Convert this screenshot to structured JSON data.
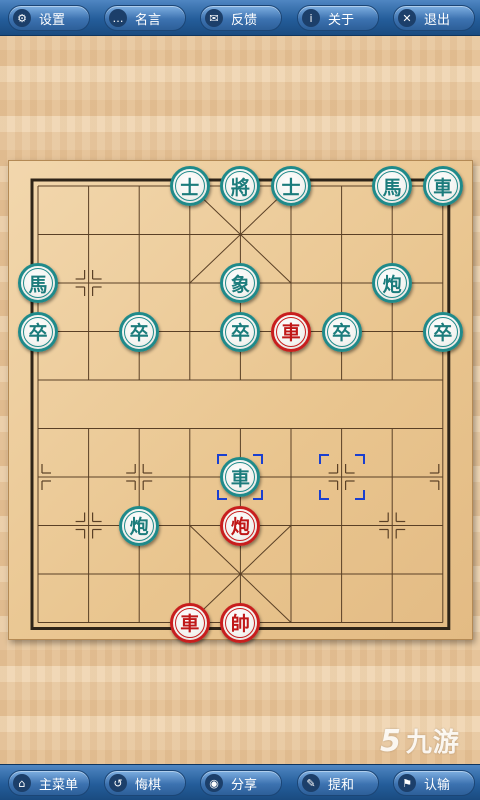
{
  "top_bar": {
    "buttons": [
      {
        "label": "设置",
        "icon": "gear-icon",
        "glyph": "⚙"
      },
      {
        "label": "名言",
        "icon": "speech-bubble-icon",
        "glyph": "…"
      },
      {
        "label": "反馈",
        "icon": "mail-icon",
        "glyph": "✉"
      },
      {
        "label": "关于",
        "icon": "info-icon",
        "glyph": "i"
      },
      {
        "label": "退出",
        "icon": "close-icon",
        "glyph": "✕"
      }
    ]
  },
  "bottom_bar": {
    "buttons": [
      {
        "label": "主菜单",
        "icon": "home-icon",
        "glyph": "⌂"
      },
      {
        "label": "悔棋",
        "icon": "undo-icon",
        "glyph": "↺"
      },
      {
        "label": "分享",
        "icon": "share-icon",
        "glyph": "◉"
      },
      {
        "label": "提和",
        "icon": "pen-icon",
        "glyph": "✎"
      },
      {
        "label": "认输",
        "icon": "flag-icon",
        "glyph": "⚑"
      }
    ]
  },
  "board": {
    "files": 9,
    "ranks": 10,
    "colors": {
      "black": "#1f8a8a",
      "red": "#c81e1e",
      "selection": "#1a3fd0"
    },
    "pieces": [
      {
        "side": "black",
        "char": "士",
        "file": 3,
        "rank": 0
      },
      {
        "side": "black",
        "char": "將",
        "file": 4,
        "rank": 0
      },
      {
        "side": "black",
        "char": "士",
        "file": 5,
        "rank": 0
      },
      {
        "side": "black",
        "char": "馬",
        "file": 7,
        "rank": 0
      },
      {
        "side": "black",
        "char": "車",
        "file": 8,
        "rank": 0
      },
      {
        "side": "black",
        "char": "馬",
        "file": 0,
        "rank": 2
      },
      {
        "side": "black",
        "char": "象",
        "file": 4,
        "rank": 2
      },
      {
        "side": "black",
        "char": "炮",
        "file": 7,
        "rank": 2
      },
      {
        "side": "black",
        "char": "卒",
        "file": 0,
        "rank": 3
      },
      {
        "side": "black",
        "char": "卒",
        "file": 2,
        "rank": 3
      },
      {
        "side": "black",
        "char": "卒",
        "file": 4,
        "rank": 3
      },
      {
        "side": "red",
        "char": "車",
        "file": 5,
        "rank": 3
      },
      {
        "side": "black",
        "char": "卒",
        "file": 6,
        "rank": 3
      },
      {
        "side": "black",
        "char": "卒",
        "file": 8,
        "rank": 3
      },
      {
        "side": "black",
        "char": "車",
        "file": 4,
        "rank": 6
      },
      {
        "side": "black",
        "char": "炮",
        "file": 2,
        "rank": 7
      },
      {
        "side": "red",
        "char": "炮",
        "file": 4,
        "rank": 7
      },
      {
        "side": "red",
        "char": "車",
        "file": 3,
        "rank": 9
      },
      {
        "side": "red",
        "char": "帥",
        "file": 4,
        "rank": 9
      }
    ],
    "last_move": {
      "from": {
        "file": 6,
        "rank": 6
      },
      "to": {
        "file": 4,
        "rank": 6
      }
    }
  },
  "watermark": {
    "mark": "5",
    "text": "九游"
  }
}
